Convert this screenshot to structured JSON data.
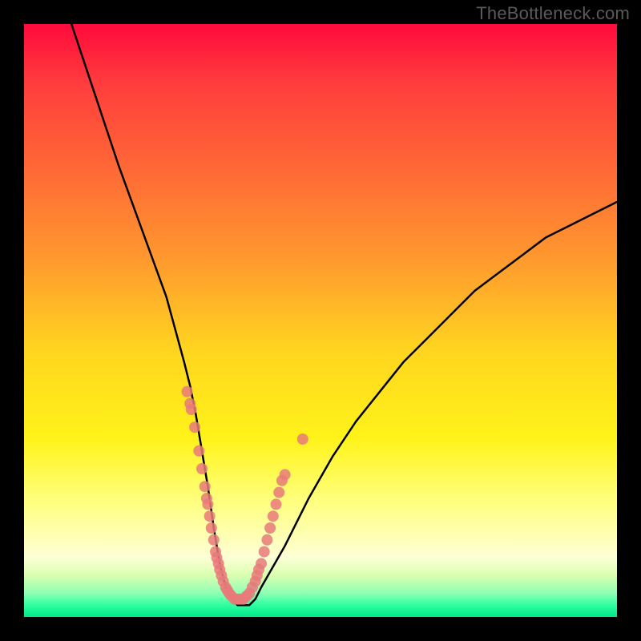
{
  "watermark": "TheBottleneck.com",
  "chart_data": {
    "type": "line",
    "title": "",
    "xlabel": "",
    "ylabel": "",
    "xlim": [
      0,
      100
    ],
    "ylim": [
      0,
      100
    ],
    "series": [
      {
        "name": "curve",
        "x": [
          8,
          12,
          16,
          20,
          24,
          27,
          28,
          29,
          30,
          31,
          32,
          33,
          34,
          35,
          36,
          37,
          38,
          39,
          40,
          44,
          48,
          52,
          56,
          60,
          64,
          68,
          72,
          76,
          80,
          84,
          88,
          92,
          96,
          100
        ],
        "values": [
          100,
          88,
          76,
          65,
          54,
          43,
          39,
          34,
          28,
          22,
          15,
          9,
          5,
          3,
          2,
          2,
          2,
          3,
          5,
          12,
          20,
          27,
          33,
          38,
          43,
          47,
          51,
          55,
          58,
          61,
          64,
          66,
          68,
          70
        ]
      },
      {
        "name": "dot-clusters",
        "x": [
          27.5,
          28.0,
          28.2,
          28.8,
          29.5,
          30.0,
          30.5,
          30.8,
          31.0,
          31.3,
          31.6,
          32.0,
          32.3,
          32.5,
          32.8,
          33.0,
          33.3,
          33.6,
          34.0,
          34.3,
          34.6,
          35.0,
          35.5,
          36.0,
          36.5,
          37.0,
          37.5,
          38.0,
          38.5,
          39.0,
          39.3,
          39.6,
          40.0,
          40.5,
          41.0,
          41.5,
          42.0,
          42.5,
          43.0,
          43.5,
          44.0,
          47.0
        ],
        "values": [
          38,
          36,
          35,
          32,
          28,
          25,
          22,
          20,
          19,
          17,
          15,
          13,
          11,
          10,
          9,
          8,
          7,
          6,
          5,
          4.5,
          4,
          3.5,
          3,
          3,
          3,
          3,
          3.5,
          4,
          5,
          6,
          7,
          8,
          9,
          11,
          13,
          15,
          17,
          19,
          21,
          23,
          24,
          30
        ]
      }
    ],
    "colors": {
      "curve": "#000000",
      "dots": "#e87a7a",
      "gradient_top": "#ff0a3c",
      "gradient_bottom": "#00e888"
    }
  }
}
